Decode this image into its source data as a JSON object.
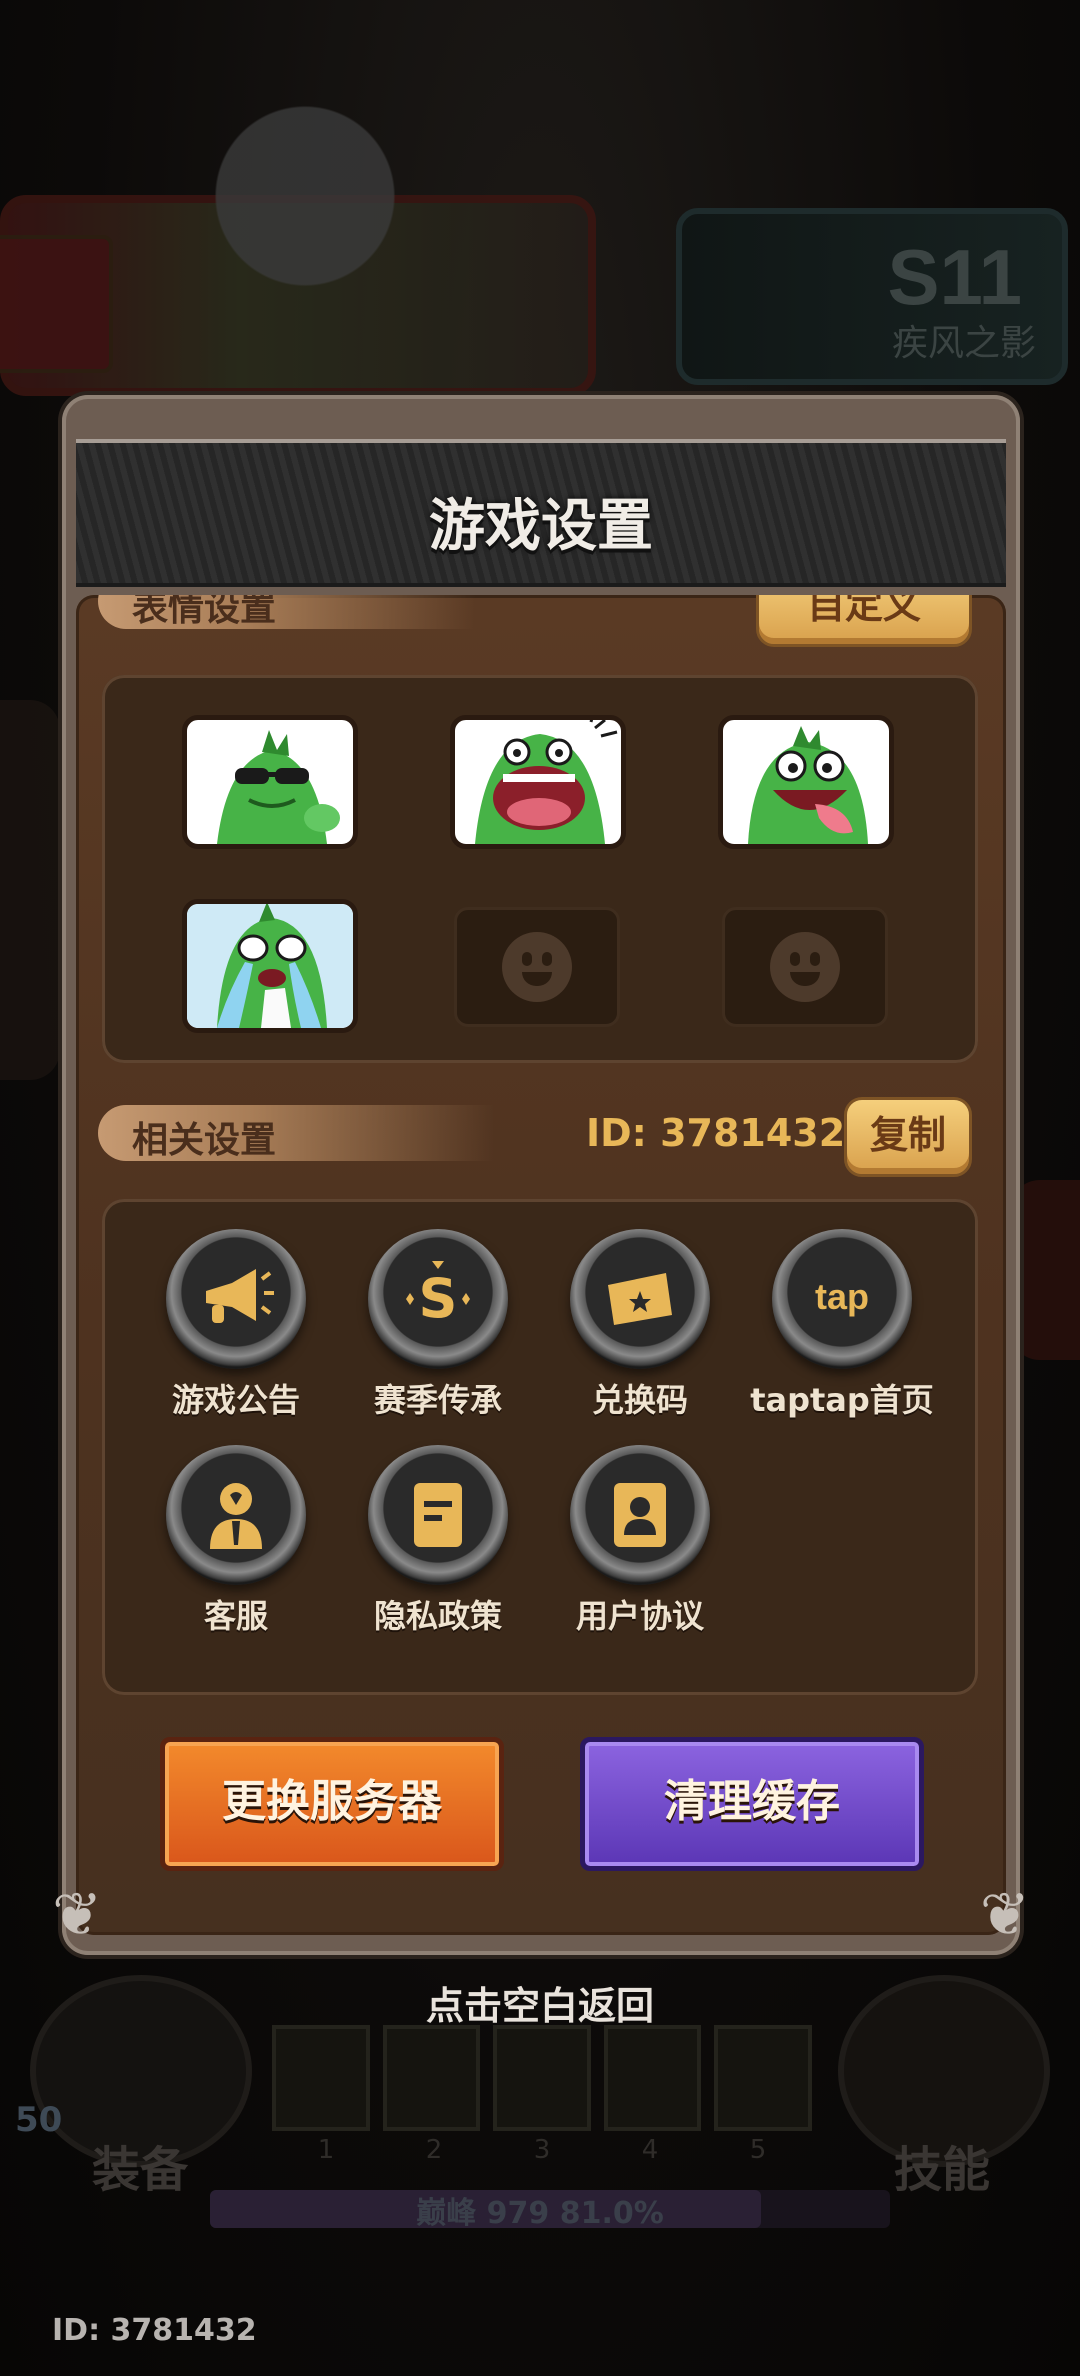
{
  "dialog": {
    "title": "游戏设置",
    "emoji_section_label": "表情设置",
    "emoji_section_button": "自定义",
    "emoji_slots": [
      "sunglasses-frog",
      "shouting-frog",
      "tongue-frog",
      "crying-frog"
    ],
    "empty_slots": 2
  },
  "related": {
    "label": "相关设置",
    "id_text": "ID: 3781432",
    "copy_button": "复制",
    "items": [
      {
        "label": "游戏公告",
        "icon": "megaphone-icon"
      },
      {
        "label": "赛季传承",
        "icon": "season-s-icon"
      },
      {
        "label": "兑换码",
        "icon": "ticket-icon"
      },
      {
        "label": "taptap首页",
        "icon": "tap-icon",
        "icon_text": "tap"
      },
      {
        "label": "客服",
        "icon": "customer-service-icon"
      },
      {
        "label": "隐私政策",
        "icon": "document-icon"
      },
      {
        "label": "用户协议",
        "icon": "user-card-icon"
      }
    ]
  },
  "buttons": {
    "switch_server": "更换服务器",
    "clear_cache": "清理缓存"
  },
  "hint": "点击空白返回",
  "background": {
    "season_badge": "S11",
    "season_name": "疾风之影",
    "equip_label": "装备",
    "skill_label": "技能",
    "level": "50",
    "slot_numbers": [
      "1",
      "2",
      "3",
      "4",
      "5"
    ],
    "progress_text": "巅峰 979 81.0%",
    "progress_fraction": 0.81,
    "footer_id": "ID: 3781432"
  },
  "colors": {
    "gold": "#e8b758",
    "orange_button": "#e06a20",
    "purple_button": "#6c47c8",
    "panel": "#3a2819"
  }
}
